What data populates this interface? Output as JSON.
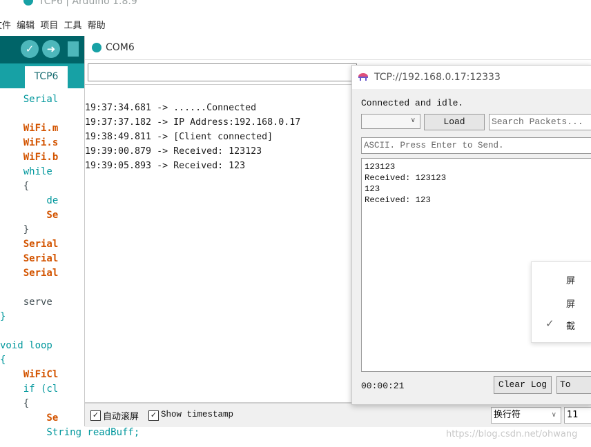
{
  "ide": {
    "title": "TCP6 | Arduino 1.8.9",
    "menu": [
      "文件",
      "编辑",
      "项目",
      "工具",
      "帮助"
    ],
    "tab": "TCP6",
    "code_lines": [
      {
        "text": "    Serial",
        "cls": "kw2"
      },
      {
        "text": "    WiFi.m",
        "cls": "kw"
      },
      {
        "text": "    WiFi.s",
        "cls": "kw"
      },
      {
        "text": "    WiFi.b",
        "cls": "kw"
      },
      {
        "text": "    while ",
        "cls": "kw2"
      },
      {
        "text": "    {",
        "cls": ""
      },
      {
        "text": "        de",
        "cls": "kw2"
      },
      {
        "text": "        Se",
        "cls": "kw"
      },
      {
        "text": "    }",
        "cls": ""
      },
      {
        "text": "    Serial",
        "cls": "kw"
      },
      {
        "text": "    Serial",
        "cls": "kw"
      },
      {
        "text": "    Serial",
        "cls": "kw"
      },
      {
        "text": "",
        "cls": ""
      },
      {
        "text": "    serve",
        "cls": ""
      },
      {
        "text": "}",
        "cls": "kw2"
      },
      {
        "text": "",
        "cls": ""
      },
      {
        "text": "void loop",
        "cls": "kw2"
      },
      {
        "text": "{",
        "cls": "kw2"
      },
      {
        "text": "    WiFiCl",
        "cls": "kw"
      },
      {
        "text": "    if (cl",
        "cls": "kw2"
      },
      {
        "text": "    {",
        "cls": ""
      },
      {
        "text": "        Se",
        "cls": "kw"
      },
      {
        "text": "        String readBuff;",
        "cls": "kw2"
      }
    ]
  },
  "serial_monitor": {
    "title": "COM6",
    "input_value": "",
    "lines": [
      "19:37:34.681 -> ......Connected",
      "19:37:37.182 -> IP Address:192.168.0.17",
      "19:38:49.811 -> [Client connected]",
      "19:39:00.879 -> Received: 123123",
      "19:39:05.893 -> Received: 123"
    ],
    "autoscroll_label": "自动滚屏",
    "timestamp_label": "Show timestamp",
    "line_ending": "换行符",
    "baud": "11"
  },
  "tcp_window": {
    "title": "TCP://192.168.0.17:12333",
    "status": "Connected and idle.",
    "load_label": "Load",
    "search_placeholder": "Search Packets...",
    "send_placeholder": "ASCII. Press Enter to Send.",
    "log": [
      "123123",
      "Received: 123123",
      "123",
      "Received: 123"
    ],
    "context_menu": [
      "屏",
      "屏",
      "截"
    ],
    "elapsed": "00:00:21",
    "clear_log_label": "Clear Log",
    "to_label": "To"
  },
  "watermark": "https://blog.csdn.net/ohwang"
}
